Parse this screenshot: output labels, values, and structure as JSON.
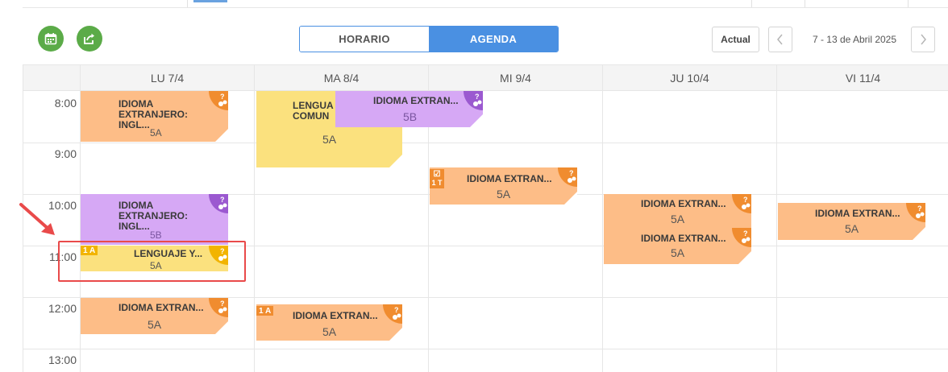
{
  "toolbar": {
    "calendar_icon": "calendar-icon",
    "share_icon": "share-icon",
    "view_options": [
      "HORARIO",
      "AGENDA"
    ],
    "active_view": "AGENDA",
    "actual_label": "Actual",
    "date_range": "7 - 13 de Abril 2025"
  },
  "days": [
    "LU 7/4",
    "MA 8/4",
    "MI 9/4",
    "JU 10/4",
    "VI 11/4"
  ],
  "times": [
    "8:00",
    "9:00",
    "10:00",
    "11:00",
    "12:00",
    "13:00"
  ],
  "events": {
    "lu_1": {
      "title": "IDIOMA EXTRANJERO: INGL...",
      "group": "5A"
    },
    "lu_2": {
      "title": "IDIOMA EXTRANJERO: INGL...",
      "group": "5B"
    },
    "lu_3": {
      "title": "LENGUAJE Y...",
      "group": "5A",
      "tag": "1 A"
    },
    "lu_4": {
      "title": "IDIOMA EXTRAN...",
      "group": "5A"
    },
    "ma_1": {
      "title": "LENGUA COMUN",
      "group": "5A"
    },
    "ma_2": {
      "title": "IDIOMA EXTRAN...",
      "group": "5B"
    },
    "ma_3": {
      "title": "IDIOMA EXTRAN...",
      "group": "5A",
      "tag": "1 A"
    },
    "mi_1": {
      "title": "IDIOMA EXTRAN...",
      "group": "5A",
      "tag": "1 T"
    },
    "ju_1": {
      "title": "IDIOMA EXTRAN...",
      "group": "5A"
    },
    "ju_2": {
      "title": "IDIOMA EXTRAN...",
      "group": "5A"
    },
    "vi_1": {
      "title": "IDIOMA EXTRAN...",
      "group": "5A"
    }
  },
  "colors": {
    "orange": "#fdbd87",
    "purple": "#d6a8f5",
    "yellow": "#fbe17e",
    "accent": "#4a90e2",
    "green": "#5bab48",
    "highlight": "#e94a4a"
  }
}
